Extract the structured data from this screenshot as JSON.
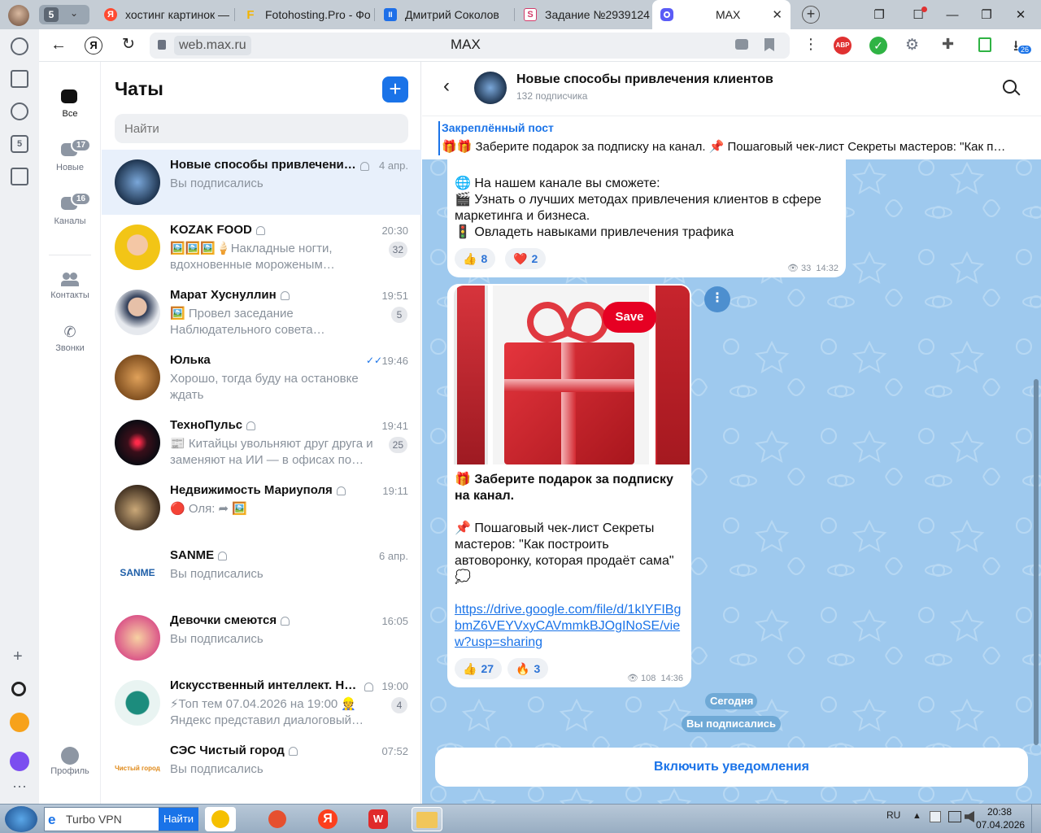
{
  "browser": {
    "tab_group_count": "5",
    "tabs": [
      {
        "title": "хостинг картинок — ",
        "favicon_letter": "Я",
        "favicon_color": "#ff4a30"
      },
      {
        "title": "Fotohosting.Pro - Фо",
        "favicon_letter": "F",
        "favicon_color": "#f3b400"
      },
      {
        "title": "Дмитрий Соколов",
        "favicon_letter": "II",
        "favicon_color": "#1e6fe8"
      },
      {
        "title": "Задание №2939124 -",
        "favicon_letter": "S",
        "favicon_color": "#d23b6a"
      },
      {
        "title": "MAX",
        "favicon_letter": "",
        "favicon_color": "#5b5cf6"
      }
    ],
    "url": "web.max.ru",
    "page_title": "MAX",
    "extension_abp_label": "ABP",
    "downloads_badge": "26"
  },
  "nav": {
    "items": [
      {
        "label": "Все",
        "badge": ""
      },
      {
        "label": "Новые",
        "badge": "17"
      },
      {
        "label": "Каналы",
        "badge": "16"
      },
      {
        "label": "Контакты",
        "badge": ""
      },
      {
        "label": "Звонки",
        "badge": ""
      }
    ],
    "profile_label": "Профиль"
  },
  "chatlist": {
    "title": "Чаты",
    "search_placeholder": "Найти",
    "chats": [
      {
        "name": "Новые способы привлечения…",
        "time": "4 апр.",
        "preview": "Вы подписались",
        "unread": "",
        "muted": true
      },
      {
        "name": "KOZAK FOOD",
        "time": "20:30",
        "preview": "🖼️🖼️🖼️🍦Накладные ногти, вдохновенные мороженым…",
        "unread": "32",
        "muted": true
      },
      {
        "name": "Марат Хуснуллин",
        "time": "19:51",
        "preview": "🖼️ Провел заседание Наблюдательного совета…",
        "unread": "5",
        "muted": true
      },
      {
        "name": "Юлька",
        "time": "19:46",
        "preview": "Хорошо, тогда буду на остановке ждать",
        "unread": "",
        "muted": false
      },
      {
        "name": "ТехноПульс",
        "time": "19:41",
        "preview": "📰 Китайцы увольняют друг друга и заменяют на ИИ — в офисах по…",
        "unread": "25",
        "muted": true
      },
      {
        "name": "Недвижимость Мариуполя",
        "time": "19:11",
        "preview": "🔴 Оля: ➦ 🖼️",
        "unread": "",
        "muted": true
      },
      {
        "name": "SANME",
        "time": "6 апр.",
        "preview": "Вы подписались",
        "unread": "",
        "muted": true
      },
      {
        "name": "Девочки смеются",
        "time": "16:05",
        "preview": "Вы подписались",
        "unread": "",
        "muted": true
      },
      {
        "name": "Искусственный интеллект. Но…",
        "time": "19:00",
        "preview": "⚡Топ тем 07.04.2026 на 19:00 👷 Яндекс представил диалоговый…",
        "unread": "4",
        "muted": true
      },
      {
        "name": "СЭС Чистый город",
        "time": "07:52",
        "preview": "Вы подписались",
        "unread": "",
        "muted": true
      }
    ],
    "avatar_texts": {
      "sanme": "SANME",
      "ses": "Чистый город"
    }
  },
  "channel": {
    "name": "Новые способы привлечения клиентов",
    "subscribers": "132 подписчика",
    "pinned_label": "Закреплённый пост",
    "pinned_text": "🎁🎁 Заберите подарок за подписку на канал. 📌 Пошаговый чек-лист Секреты мастеров: \"Как п…",
    "msg1": {
      "line1": "🌐 На нашем канале вы сможете:",
      "line2": "🎬 Узнать о лучших методах привлечения клиентов в сфере маркетинга и бизнеса.",
      "line3": "🚦 Овладеть навыками привлечения трафика",
      "reactions": [
        {
          "emoji": "👍",
          "count": "8"
        },
        {
          "emoji": "❤️",
          "count": "2"
        }
      ],
      "views": "33",
      "time": "14:32"
    },
    "msg2": {
      "save_label": "Save",
      "title": "🎁 Заберите подарок за подписку на канал.",
      "text": "📌 Пошаговый чек-лист Секреты мастеров: \"Как построить автоворонку, которая продаёт сама\" 💭",
      "link": "https://drive.google.com/file/d/1kIYFIBgbmZ6VEYVxyCAVmmkBJOgINoSE/view?usp=sharing",
      "reactions": [
        {
          "emoji": "👍",
          "count": "27"
        },
        {
          "emoji": "🔥",
          "count": "3"
        }
      ],
      "views": "108",
      "time": "14:36"
    },
    "date_pill": "Сегодня",
    "subscribed_pill": "Вы подписались",
    "notify_button": "Включить уведомления"
  },
  "taskbar": {
    "search_value": "Turbo VPN",
    "search_button": "Найти",
    "lang": "RU",
    "time": "20:38",
    "date": "07.04.2026"
  },
  "colors": {
    "accent": "#1a73e8",
    "selected_chat": "#e8f0fb",
    "chat_bg": "#9ec9ee"
  }
}
